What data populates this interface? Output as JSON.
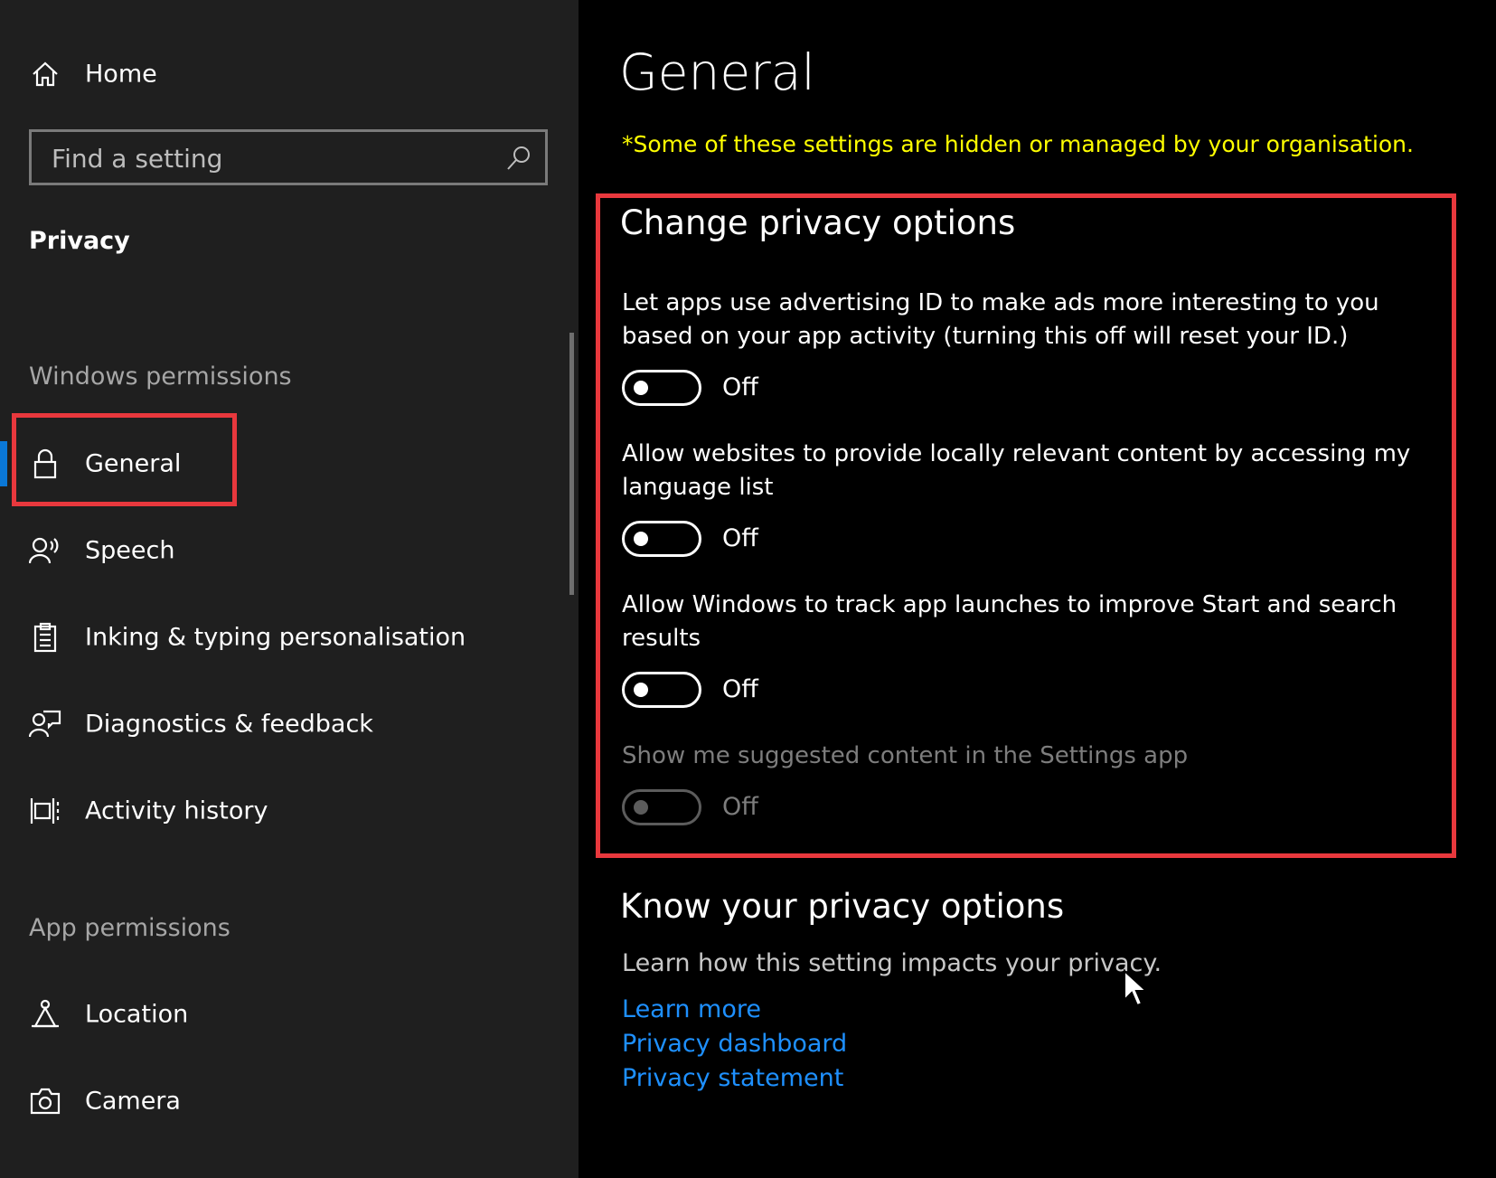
{
  "sidebar": {
    "home_label": "Home",
    "search_placeholder": "Find a setting",
    "section_title": "Privacy",
    "windows_permissions_label": "Windows permissions",
    "windows_items": [
      {
        "label": "General",
        "icon": "lock-icon",
        "selected": true
      },
      {
        "label": "Speech",
        "icon": "speech-icon"
      },
      {
        "label": "Inking & typing personalisation",
        "icon": "clipboard-icon"
      },
      {
        "label": "Diagnostics & feedback",
        "icon": "diagnostics-feedback-icon"
      },
      {
        "label": "Activity history",
        "icon": "activity-history-icon"
      }
    ],
    "app_permissions_label": "App permissions",
    "app_items": [
      {
        "label": "Location",
        "icon": "location-icon"
      },
      {
        "label": "Camera",
        "icon": "camera-icon"
      }
    ]
  },
  "main": {
    "title": "General",
    "managed_notice": "*Some of these settings are hidden or managed by your organisation.",
    "change_options": {
      "heading": "Change privacy options",
      "settings": [
        {
          "description": "Let apps use advertising ID to make ads more interesting to you based on your app activity (turning this off will reset your ID.)",
          "state": "Off",
          "enabled": true
        },
        {
          "description": "Allow websites to provide locally relevant content by accessing my language list",
          "state": "Off",
          "enabled": true
        },
        {
          "description": "Allow Windows to track app launches to improve Start and search results",
          "state": "Off",
          "enabled": true
        },
        {
          "description": "Show me suggested content in the Settings app",
          "state": "Off",
          "enabled": false
        }
      ]
    },
    "know_options": {
      "heading": "Know your privacy options",
      "subtitle": "Learn how this setting impacts your privacy.",
      "links": [
        "Learn more",
        "Privacy dashboard",
        "Privacy statement"
      ]
    }
  },
  "colors": {
    "accent": "#0a78d7",
    "highlight_border": "#e8383d",
    "notice": "#ffff00",
    "link": "#1e90ff",
    "sidebar_bg": "#1f1f1f"
  }
}
